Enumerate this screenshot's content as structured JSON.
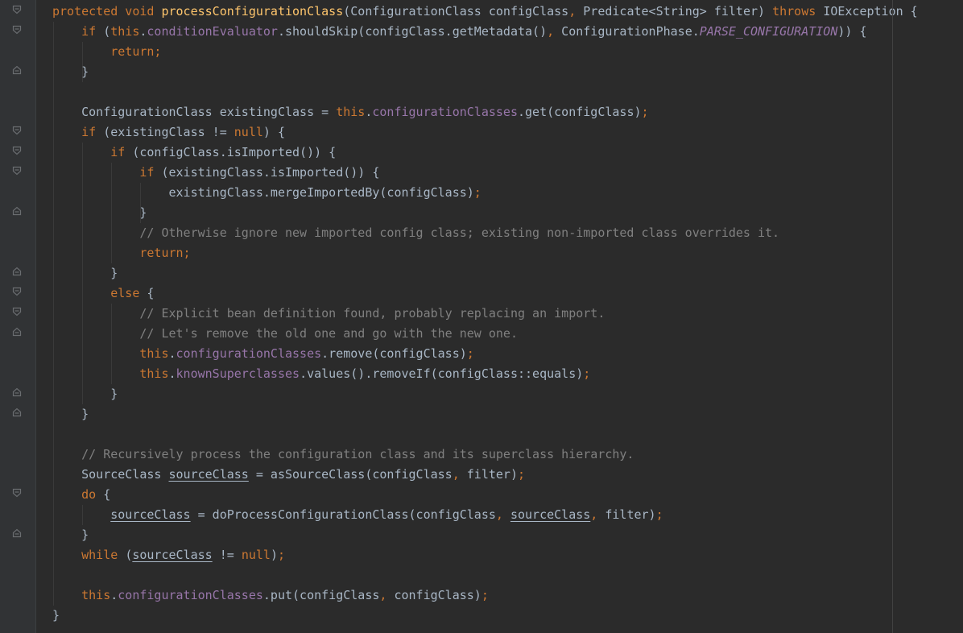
{
  "editor": {
    "colors": {
      "background": "#2b2b2b",
      "gutter": "#313335",
      "default_text": "#a9b7c6",
      "keyword": "#cc7832",
      "method_declaration": "#ffc66d",
      "field": "#9876aa",
      "comment": "#808080"
    },
    "fold_markers": [
      {
        "line": 1,
        "type": "open"
      },
      {
        "line": 2,
        "type": "open"
      },
      {
        "line": 4,
        "type": "close"
      },
      {
        "line": 7,
        "type": "open"
      },
      {
        "line": 8,
        "type": "open"
      },
      {
        "line": 9,
        "type": "open"
      },
      {
        "line": 11,
        "type": "close"
      },
      {
        "line": 14,
        "type": "close"
      },
      {
        "line": 15,
        "type": "open"
      },
      {
        "line": 16,
        "type": "open"
      },
      {
        "line": 17,
        "type": "close"
      },
      {
        "line": 20,
        "type": "close"
      },
      {
        "line": 21,
        "type": "close"
      },
      {
        "line": 25,
        "type": "open"
      },
      {
        "line": 27,
        "type": "close"
      }
    ],
    "lines": [
      [
        [
          "kw",
          "protected void "
        ],
        [
          "fn",
          "processConfigurationClass"
        ],
        [
          "pl",
          "(ConfigurationClass configClass"
        ],
        [
          "kw",
          ", "
        ],
        [
          "pl",
          "Predicate<String> filter) "
        ],
        [
          "kw",
          "throws "
        ],
        [
          "pl",
          "IOException {"
        ]
      ],
      [
        [
          "pl",
          "    "
        ],
        [
          "kw",
          "if "
        ],
        [
          "pl",
          "("
        ],
        [
          "kw",
          "this"
        ],
        [
          "pl",
          "."
        ],
        [
          "fld",
          "conditionEvaluator"
        ],
        [
          "pl",
          ".shouldSkip(configClass.getMetadata()"
        ],
        [
          "kw",
          ", "
        ],
        [
          "pl",
          "ConfigurationPhase."
        ],
        [
          "cst",
          "PARSE_CONFIGURATION"
        ],
        [
          "pl",
          ")) {"
        ]
      ],
      [
        [
          "pl",
          "        "
        ],
        [
          "kw",
          "return;"
        ]
      ],
      [
        [
          "pl",
          "    }"
        ]
      ],
      [
        [
          "pl",
          ""
        ]
      ],
      [
        [
          "pl",
          "    ConfigurationClass existingClass = "
        ],
        [
          "kw",
          "this"
        ],
        [
          "pl",
          "."
        ],
        [
          "fld",
          "configurationClasses"
        ],
        [
          "pl",
          ".get(configClass)"
        ],
        [
          "kw",
          ";"
        ]
      ],
      [
        [
          "pl",
          "    "
        ],
        [
          "kw",
          "if "
        ],
        [
          "pl",
          "(existingClass != "
        ],
        [
          "kw",
          "null"
        ],
        [
          "pl",
          ") {"
        ]
      ],
      [
        [
          "pl",
          "        "
        ],
        [
          "kw",
          "if "
        ],
        [
          "pl",
          "(configClass.isImported()) {"
        ]
      ],
      [
        [
          "pl",
          "            "
        ],
        [
          "kw",
          "if "
        ],
        [
          "pl",
          "(existingClass.isImported()) {"
        ]
      ],
      [
        [
          "pl",
          "                existingClass.mergeImportedBy(configClass)"
        ],
        [
          "kw",
          ";"
        ]
      ],
      [
        [
          "pl",
          "            }"
        ]
      ],
      [
        [
          "pl",
          "            "
        ],
        [
          "cm",
          "// Otherwise ignore new imported config class; existing non-imported class overrides it."
        ]
      ],
      [
        [
          "pl",
          "            "
        ],
        [
          "kw",
          "return;"
        ]
      ],
      [
        [
          "pl",
          "        }"
        ]
      ],
      [
        [
          "pl",
          "        "
        ],
        [
          "kw",
          "else "
        ],
        [
          "pl",
          "{"
        ]
      ],
      [
        [
          "pl",
          "            "
        ],
        [
          "cm",
          "// Explicit bean definition found, probably replacing an import."
        ]
      ],
      [
        [
          "pl",
          "            "
        ],
        [
          "cm",
          "// Let's remove the old one and go with the new one."
        ]
      ],
      [
        [
          "pl",
          "            "
        ],
        [
          "kw",
          "this"
        ],
        [
          "pl",
          "."
        ],
        [
          "fld",
          "configurationClasses"
        ],
        [
          "pl",
          ".remove(configClass)"
        ],
        [
          "kw",
          ";"
        ]
      ],
      [
        [
          "pl",
          "            "
        ],
        [
          "kw",
          "this"
        ],
        [
          "pl",
          "."
        ],
        [
          "fld",
          "knownSuperclasses"
        ],
        [
          "pl",
          ".values().removeIf(configClass::equals)"
        ],
        [
          "kw",
          ";"
        ]
      ],
      [
        [
          "pl",
          "        }"
        ]
      ],
      [
        [
          "pl",
          "    }"
        ]
      ],
      [
        [
          "pl",
          ""
        ]
      ],
      [
        [
          "pl",
          "    "
        ],
        [
          "cm",
          "// Recursively process the configuration class and its superclass hierarchy."
        ]
      ],
      [
        [
          "pl",
          "    SourceClass "
        ],
        [
          "ul",
          "sourceClass"
        ],
        [
          "pl",
          " = asSourceClass(configClass"
        ],
        [
          "kw",
          ", "
        ],
        [
          "pl",
          "filter)"
        ],
        [
          "kw",
          ";"
        ]
      ],
      [
        [
          "pl",
          "    "
        ],
        [
          "kw",
          "do "
        ],
        [
          "pl",
          "{"
        ]
      ],
      [
        [
          "pl",
          "        "
        ],
        [
          "ul",
          "sourceClass"
        ],
        [
          "pl",
          " = doProcessConfigurationClass(configClass"
        ],
        [
          "kw",
          ", "
        ],
        [
          "ul",
          "sourceClass"
        ],
        [
          "kw",
          ", "
        ],
        [
          "pl",
          "filter)"
        ],
        [
          "kw",
          ";"
        ]
      ],
      [
        [
          "pl",
          "    }"
        ]
      ],
      [
        [
          "pl",
          "    "
        ],
        [
          "kw",
          "while "
        ],
        [
          "pl",
          "("
        ],
        [
          "ul",
          "sourceClass"
        ],
        [
          "pl",
          " != "
        ],
        [
          "kw",
          "null"
        ],
        [
          "pl",
          ")"
        ],
        [
          "kw",
          ";"
        ]
      ],
      [
        [
          "pl",
          ""
        ]
      ],
      [
        [
          "pl",
          "    "
        ],
        [
          "kw",
          "this"
        ],
        [
          "pl",
          "."
        ],
        [
          "fld",
          "configurationClasses"
        ],
        [
          "pl",
          ".put(configClass"
        ],
        [
          "kw",
          ", "
        ],
        [
          "pl",
          "configClass)"
        ],
        [
          "kw",
          ";"
        ]
      ],
      [
        [
          "pl",
          "}"
        ]
      ]
    ]
  }
}
